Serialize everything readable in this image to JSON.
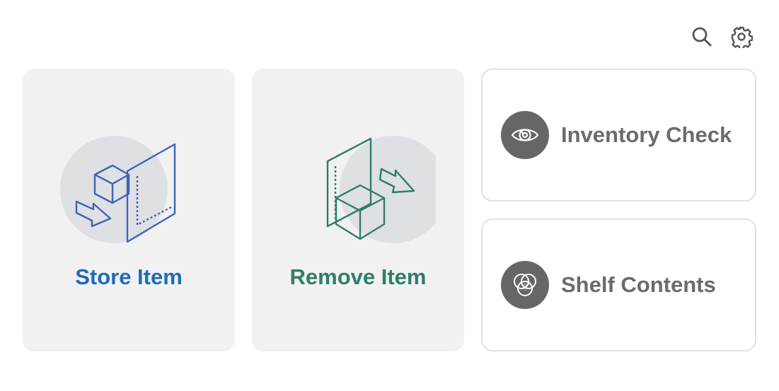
{
  "toolbar": {
    "search_icon": "search-icon",
    "settings_icon": "gear-icon"
  },
  "actions": {
    "store": {
      "label": "Store Item",
      "color": "#1e6bb8",
      "icon": "store-item-illustration"
    },
    "remove": {
      "label": "Remove Item",
      "color": "#2e7d6b",
      "icon": "remove-item-illustration"
    }
  },
  "tiles": {
    "inventory": {
      "label": "Inventory Check",
      "icon": "eye-icon"
    },
    "shelf": {
      "label": "Shelf Contents",
      "icon": "shelf-contents-icon"
    }
  }
}
